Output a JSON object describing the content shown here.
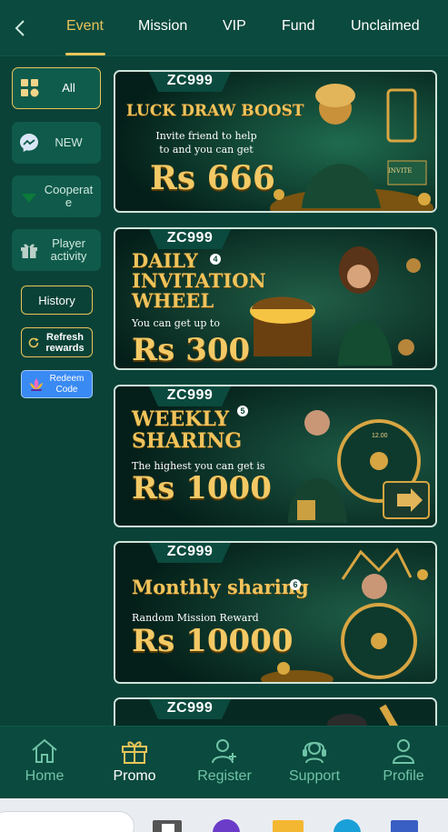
{
  "tabs": [
    {
      "label": "Event",
      "active": true
    },
    {
      "label": "Mission",
      "active": false
    },
    {
      "label": "VIP",
      "active": false
    },
    {
      "label": "Fund",
      "active": false
    },
    {
      "label": "Unclaimed",
      "active": false
    }
  ],
  "sidebar": {
    "items": [
      {
        "label": "All",
        "icon": "grid-icon",
        "active": true
      },
      {
        "label": "NEW",
        "icon": "messenger-icon",
        "active": false
      },
      {
        "label": "Cooperat e",
        "icon": "triangle-down-icon",
        "active": false
      },
      {
        "label": "Player activity",
        "icon": "gift-icon",
        "active": false
      }
    ],
    "history_label": "History",
    "refresh_label": "Refresh rewards",
    "redeem_label": "Redeem Code"
  },
  "banners": [
    {
      "brand": "ZC999",
      "title": "LUCK DRAW BOOST",
      "subtitle": "Invite friend to help to and you can get",
      "amount": "Rs 666",
      "badge": "INVITE"
    },
    {
      "brand": "ZC999",
      "title": "DAILY INVITATION WHEEL",
      "number": "4",
      "subtitle": "You can get up to",
      "amount": "Rs 300"
    },
    {
      "brand": "ZC999",
      "title": "WEEKLY SHARING",
      "number": "5",
      "subtitle": "The highest you can get is",
      "amount": "Rs 1000",
      "wheel_text": "12.00"
    },
    {
      "brand": "ZC999",
      "title": "Monthly sharing",
      "number": "6",
      "subtitle": "Random Mission Reward",
      "amount": "Rs 10000"
    },
    {
      "brand": "ZC999"
    }
  ],
  "bottom_nav": [
    {
      "label": "Home",
      "icon": "home-icon",
      "active": false
    },
    {
      "label": "Promo",
      "icon": "gift-box-icon",
      "active": true
    },
    {
      "label": "Register",
      "icon": "add-user-icon",
      "active": false
    },
    {
      "label": "Support",
      "icon": "headset-icon",
      "active": false
    },
    {
      "label": "Profile",
      "icon": "user-icon",
      "active": false
    }
  ],
  "colors": {
    "background": "#0a4237",
    "accent": "#e9c45a",
    "nav_inactive": "#6fc3a6"
  }
}
